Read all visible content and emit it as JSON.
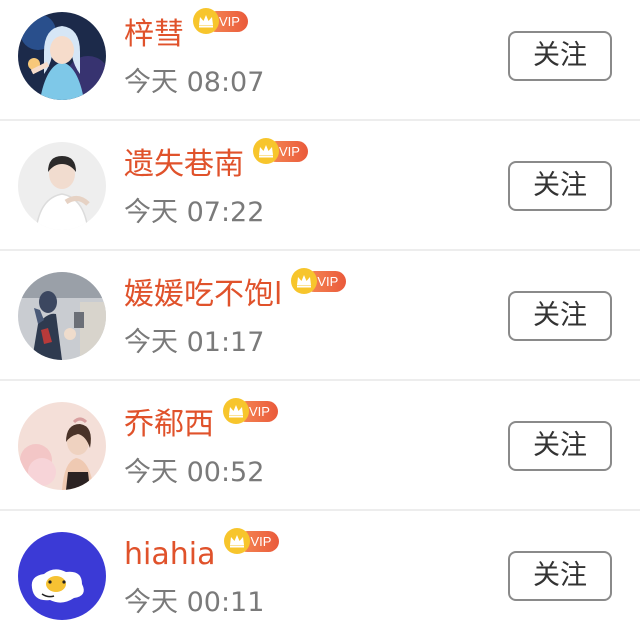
{
  "colors": {
    "name": "#e0522b",
    "time": "#7a7a7a",
    "vip_badge": "#ea5a3b",
    "crown": "#f2b418",
    "divider": "#ededed"
  },
  "users": [
    {
      "name": "梓彗",
      "vip_label": "VIP",
      "time": "今天 08:07",
      "follow_label": "关注",
      "avatar_icon": "anime-girl-avatar"
    },
    {
      "name": "遗失巷南",
      "vip_label": "VIP",
      "time": "今天 07:22",
      "follow_label": "关注",
      "avatar_icon": "boy-portrait-avatar"
    },
    {
      "name": "媛媛吃不饱l",
      "vip_label": "VIP",
      "time": "今天 01:17",
      "follow_label": "关注",
      "avatar_icon": "ultraman-figure-avatar"
    },
    {
      "name": "乔郗西",
      "vip_label": "VIP",
      "time": "今天 00:52",
      "follow_label": "关注",
      "avatar_icon": "girl-photo-avatar"
    },
    {
      "name": "hiahia",
      "vip_label": "VIP",
      "time": "今天 00:11",
      "follow_label": "关注",
      "avatar_icon": "fried-egg-avatar"
    }
  ]
}
